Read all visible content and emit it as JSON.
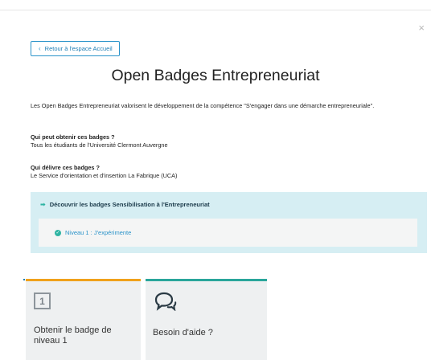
{
  "close_label": "×",
  "back_button": {
    "label": "Retour à l'espace Accueil",
    "icon": "chevron-left-icon"
  },
  "page_title": "Open Badges Entrepreneuriat",
  "intro_text": "Les Open Badges Entrepreneuriat valorisent le développement de la compétence \"S'engager dans une démarche entrepreneuriale\".",
  "qa": [
    {
      "question": "Qui peut obtenir ces badges ?",
      "answer": "Tous les étudiants de l'Université Clermont Auvergne"
    },
    {
      "question": "Qui délivre ces badges ?",
      "answer": "Le Service d'orientation et d'insertion La Fabrique (UCA)"
    }
  ],
  "discover": {
    "heading": "Découvrir les badges Sensibilisation à l'Entrepreneuriat",
    "level_label": "Niveau 1 : J'expérimente"
  },
  "cards": [
    {
      "badge_number": "1",
      "label": "Obtenir le badge de niveau 1",
      "accent": "#f0a11c"
    },
    {
      "label": "Besoin d'aide ?",
      "accent": "#2aa69b",
      "icon": "chat-bubbles-icon"
    }
  ],
  "colors": {
    "link_blue": "#2a93c9",
    "panel_bg": "#d6eef3",
    "teal": "#2fb4a3"
  }
}
